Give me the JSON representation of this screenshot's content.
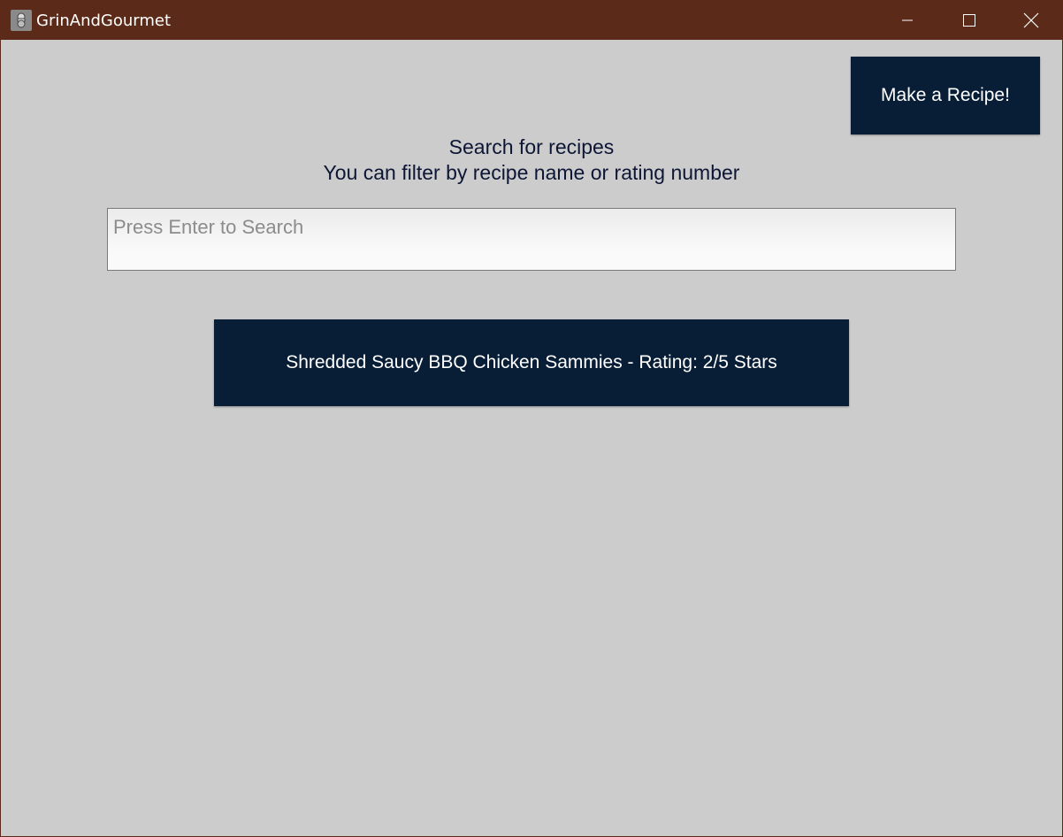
{
  "window": {
    "title": "GrinAndGourmet",
    "icon": "chef-logo-icon",
    "controls": {
      "minimize_icon": "minimize-icon",
      "maximize_icon": "maximize-icon",
      "close_icon": "close-icon"
    }
  },
  "header": {
    "make_recipe_label": "Make a Recipe!"
  },
  "search": {
    "title": "Search for recipes",
    "subtitle": "You can filter by recipe name or rating number",
    "placeholder": "Press Enter to Search",
    "value": ""
  },
  "results": [
    {
      "label": "Shredded Saucy BBQ Chicken Sammies - Rating: 2/5 Stars"
    }
  ],
  "colors": {
    "titlebar": "#5c2a18",
    "background": "#cccccc",
    "button": "#081e36",
    "heading_text": "#0d1635"
  }
}
